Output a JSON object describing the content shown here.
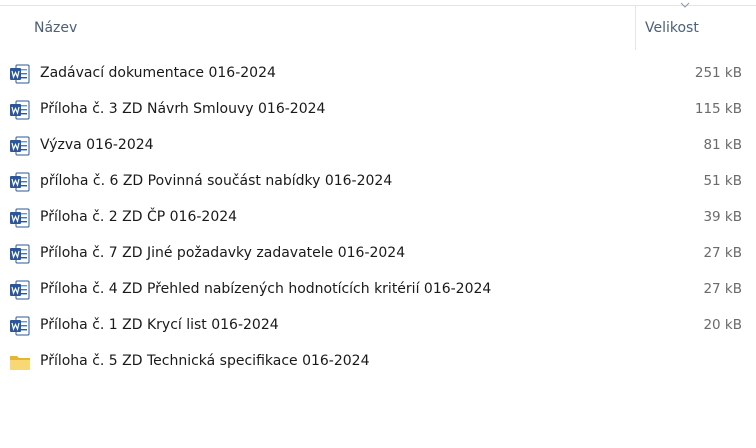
{
  "header": {
    "name_label": "Název",
    "size_label": "Velikost"
  },
  "files": [
    {
      "name": "Zadávací dokumentace 016-2024",
      "size": "251 kB",
      "icon": "word-document-icon"
    },
    {
      "name": "Příloha č. 3 ZD Návrh Smlouvy 016-2024",
      "size": "115 kB",
      "icon": "word-document-icon"
    },
    {
      "name": "Výzva 016-2024",
      "size": "81 kB",
      "icon": "word-document-icon"
    },
    {
      "name": "příloha č. 6 ZD Povinná součást nabídky 016-2024",
      "size": "51 kB",
      "icon": "word-document-icon"
    },
    {
      "name": "Příloha č. 2 ZD ČP 016-2024",
      "size": "39 kB",
      "icon": "word-document-icon"
    },
    {
      "name": "Příloha č. 7 ZD Jiné požadavky zadavatele 016-2024",
      "size": "27 kB",
      "icon": "word-document-icon"
    },
    {
      "name": "Příloha č. 4 ZD Přehled nabízených hodnotících kritérií  016-2024",
      "size": "27 kB",
      "icon": "word-document-icon"
    },
    {
      "name": "Příloha č. 1 ZD Krycí list 016-2024",
      "size": "20 kB",
      "icon": "word-document-icon"
    },
    {
      "name": "Příloha č. 5 ZD Technická specifikace 016-2024",
      "size": "",
      "icon": "folder-icon"
    }
  ],
  "colors": {
    "header_text": "#4c607a",
    "word_blue": "#2b579a",
    "folder_yellow": "#f3c444"
  }
}
